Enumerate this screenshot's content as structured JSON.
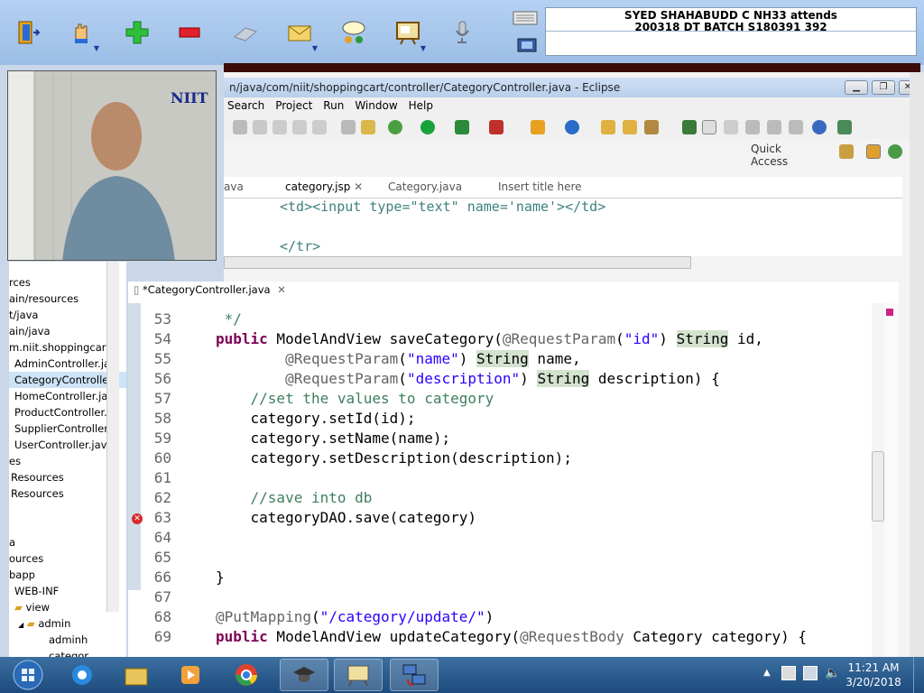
{
  "attendee": {
    "line1": "SYED SHAHABUDD C NH33 attends",
    "line2": "200318  DT  BATCH  S180391  392"
  },
  "video": {
    "logo": "NIIT"
  },
  "eclipse": {
    "title": "n/java/com/niit/shoppingcart/controller/CategoryController.java - Eclipse",
    "menu": [
      "Search",
      "Project",
      "Run",
      "Window",
      "Help"
    ],
    "quick_access": "Quick Access",
    "top_tabs": [
      "ava",
      "category.jsp",
      "Category.java",
      "Insert title here"
    ],
    "top_code": [
      "<td><input type=\"text\" name='name'></td>",
      "</tr>"
    ]
  },
  "tree": {
    "items": [
      "rces",
      "ain/resources",
      "t/java",
      "ain/java",
      "m.niit.shoppingcart",
      "AdminController.ja",
      "CategoryControlle",
      "HomeController.ja",
      "ProductController.",
      "SupplierController.",
      "UserController.java",
      "es",
      "Resources",
      "Resources",
      "",
      "",
      "a",
      "ources",
      "bapp",
      "WEB-INF",
      "view",
      "admin",
      "adminh",
      "categor"
    ]
  },
  "editor": {
    "tab": "*CategoryController.java",
    "lines": [
      {
        "n": "53",
        "c": " */"
      },
      {
        "n": "54",
        "c": "public ModelAndView saveCategory(@RequestParam(\"id\") String id,"
      },
      {
        "n": "55",
        "c": "        @RequestParam(\"name\") String name,"
      },
      {
        "n": "56",
        "c": "        @RequestParam(\"description\") String description) {"
      },
      {
        "n": "57",
        "c": "    //set the values to category"
      },
      {
        "n": "58",
        "c": "    category.setId(id);"
      },
      {
        "n": "59",
        "c": "    category.setName(name);"
      },
      {
        "n": "60",
        "c": "    category.setDescription(description);"
      },
      {
        "n": "61",
        "c": ""
      },
      {
        "n": "62",
        "c": "    //save into db"
      },
      {
        "n": "63",
        "c": "    categoryDAO.save(category)"
      },
      {
        "n": "64",
        "c": ""
      },
      {
        "n": "65",
        "c": ""
      },
      {
        "n": "66",
        "c": "}"
      },
      {
        "n": "67",
        "c": ""
      },
      {
        "n": "68",
        "c": "@PutMapping(\"/category/update/\")"
      },
      {
        "n": "69",
        "c": "public ModelAndView updateCategory(@RequestBody Category category) {"
      }
    ]
  },
  "taskbar": {
    "time": "11:21 AM",
    "date": "3/20/2018"
  },
  "colors": {
    "keyword": "#7f0055",
    "string": "#2a00ff",
    "comment": "#3f7f5f",
    "taskbar": "#1d4b7e"
  }
}
